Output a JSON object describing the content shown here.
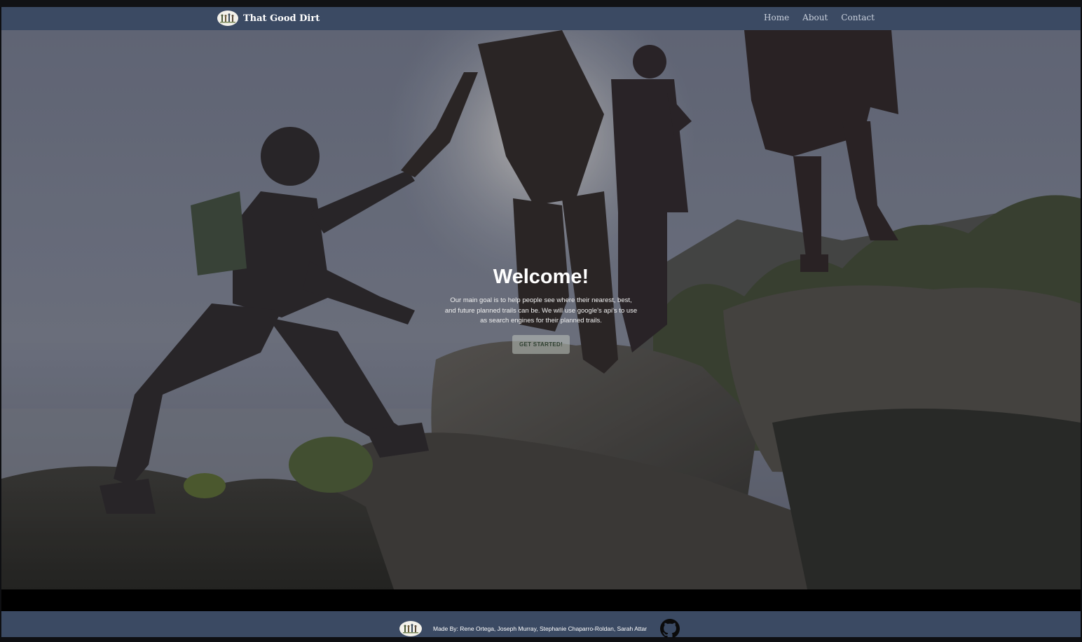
{
  "brand": {
    "name": "That Good Dirt",
    "logo_icon": "hikers-logo-icon"
  },
  "nav": {
    "items": [
      {
        "label": "Home"
      },
      {
        "label": "About"
      },
      {
        "label": "Contact"
      }
    ]
  },
  "hero": {
    "title": "Welcome!",
    "description": "Our main goal is to help people see where their nearest, best, and future planned trails can be. We will use google's api's to use as search engines for their planned trails.",
    "cta_label": "GET STARTED!",
    "background": "hikers-on-rocky-trail-photo"
  },
  "footer": {
    "credits": "Made By: Rene Ortega, Joseph Murray, Stephanie Chaparro-Roldan, Sarah Attar",
    "github_icon": "github-icon"
  },
  "colors": {
    "navbar": "#3b4a63",
    "footer": "#3b4a63",
    "cta_text": "#2f4032"
  }
}
